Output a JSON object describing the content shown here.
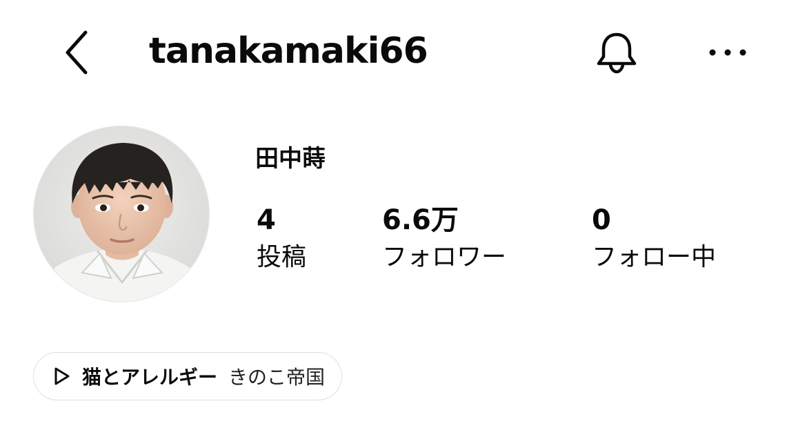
{
  "header": {
    "username": "tanakamaki66",
    "back_icon": "chevron-left-icon",
    "bell_icon": "bell-icon",
    "more_icon": "more-horizontal-icon"
  },
  "profile": {
    "display_name": "田中蒔",
    "avatar": "profile-photo",
    "stats": {
      "posts": {
        "value": "4",
        "label": "投稿"
      },
      "followers": {
        "value": "6.6万",
        "label": "フォロワー"
      },
      "following": {
        "value": "0",
        "label": "フォロー中"
      }
    }
  },
  "music": {
    "icon": "play-icon",
    "title": "猫とアレルギー",
    "artist": "きのこ帝国"
  }
}
